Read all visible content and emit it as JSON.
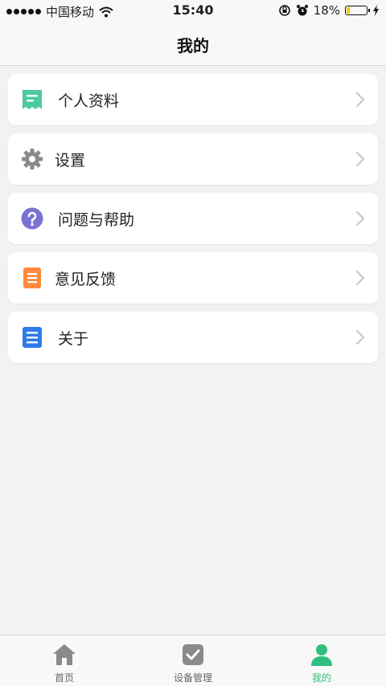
{
  "status_bar": {
    "carrier": "中国移动",
    "time": "15:40",
    "battery": "18%",
    "battery_level": 0.18
  },
  "nav": {
    "title": "我的"
  },
  "menu": {
    "items": [
      {
        "label": "个人资料",
        "icon": "profile-icon",
        "color": "#4cc8a3"
      },
      {
        "label": "设置",
        "icon": "gear-icon",
        "color": "#888888"
      },
      {
        "label": "问题与帮助",
        "icon": "question-icon",
        "color": "#7b72d6"
      },
      {
        "label": "意见反馈",
        "icon": "feedback-icon",
        "color": "#ff8a3d"
      },
      {
        "label": "关于",
        "icon": "about-icon",
        "color": "#2f7be8"
      }
    ]
  },
  "tabbar": {
    "tabs": [
      {
        "label": "首页",
        "icon": "home-icon",
        "active": false
      },
      {
        "label": "设备管理",
        "icon": "device-manage-icon",
        "active": false
      },
      {
        "label": "我的",
        "icon": "user-icon",
        "active": true
      }
    ],
    "active_color": "#2fbf7d",
    "inactive_color": "#888888"
  }
}
